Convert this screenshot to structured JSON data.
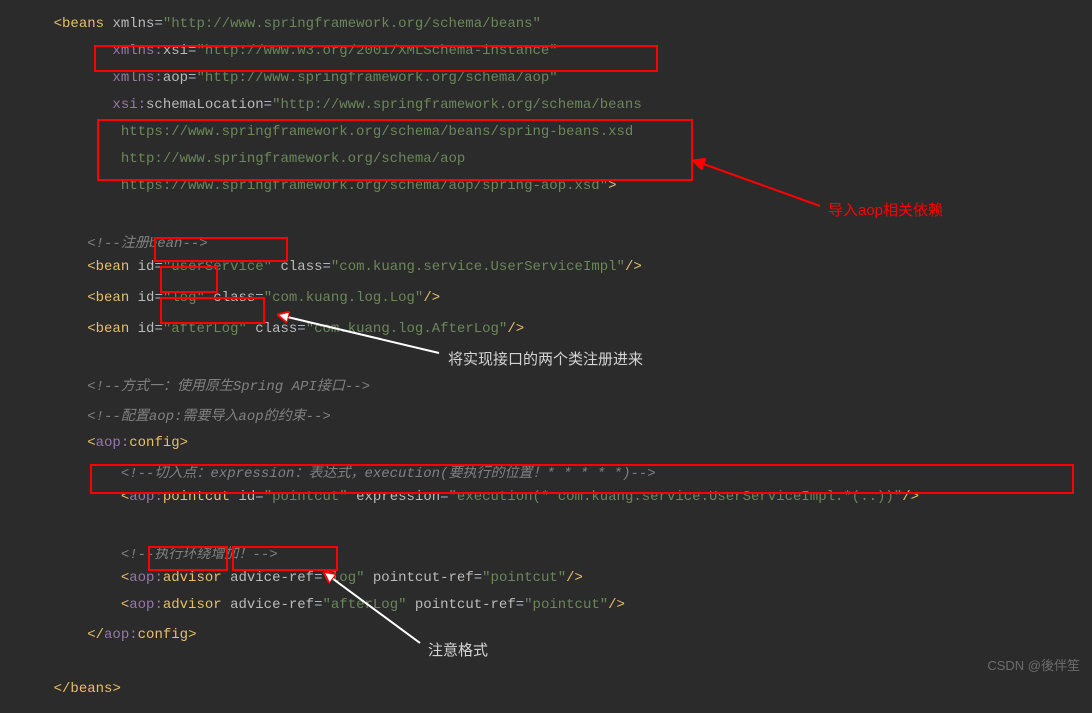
{
  "lines": {
    "l1": {
      "pre": "<",
      "tag": "beans ",
      "attr": "xmlns",
      "eq": "=",
      "str": "\"http://www.springframework.org/schema/beans\""
    },
    "l2": {
      "ns": "       xmlns:",
      "attr": "xsi",
      "eq": "=",
      "str": "\"http://www.w3.org/2001/XMLSchema-instance\""
    },
    "l3": {
      "ns": "       xmlns:",
      "attr": "aop",
      "eq": "=",
      "str": "\"http://www.springframework.org/schema/aop\""
    },
    "l4": {
      "ns": "       xsi:",
      "attr": "schemaLocation",
      "eq": "=",
      "str": "\"http://www.springframework.org/schema/beans"
    },
    "l5": {
      "str": "        https://www.springframework.org/schema/beans/spring-beans.xsd"
    },
    "l6": {
      "str": "        http://www.springframework.org/schema/aop"
    },
    "l7": {
      "str": "        https://www.springframework.org/schema/aop/spring-aop.xsd\"",
      "close": ">"
    },
    "l8": {
      "comment": "    <!--注册bean-->"
    },
    "l9": {
      "pre": "    <",
      "tag": "bean ",
      "a1": "id",
      "v1": "\"userService\"",
      "a2": "class",
      "v2": "\"com.kuang.service.UserServiceImpl\"",
      "close": "/>"
    },
    "l10": {
      "pre": "    <",
      "tag": "bean ",
      "a1": "id",
      "v1": "\"log\"",
      "a2": "class",
      "v2": "\"com.kuang.log.Log\"",
      "close": "/>"
    },
    "l11": {
      "pre": "    <",
      "tag": "bean ",
      "a1": "id",
      "v1": "\"afterLog\"",
      "a2": "class",
      "v2": "\"com.kuang.log.AfterLog\"",
      "close": "/>"
    },
    "l12": {
      "comment": "    <!--方式一：使用原生Spring API接口-->"
    },
    "l13": {
      "comment": "    <!--配置aop:需要导入aop的约束-->"
    },
    "l14": {
      "pre": "    <",
      "ns": "aop:",
      "tag": "config",
      "close": ">"
    },
    "l15": {
      "comment": "        <!--切入点：expression：表达式，execution(要执行的位置！* * * * *)-->"
    },
    "l16": {
      "pre": "        <",
      "ns": "aop:",
      "tag": "pointcut ",
      "a1": "id",
      "v1": "\"pointcut\"",
      "a2": "expression",
      "v2": "\"execution(* com.kuang.service.UserServiceImpl.*(..))\"",
      "close": "/>"
    },
    "l17": {
      "comment": "        <!--执行环绕增加！-->"
    },
    "l18": {
      "pre": "        <",
      "ns": "aop:",
      "tag": "advisor ",
      "a1": "advice-ref",
      "v1": "\"log\"",
      "a2": "pointcut-ref",
      "v2": "\"pointcut\"",
      "close": "/>"
    },
    "l19": {
      "pre": "        <",
      "ns": "aop:",
      "tag": "advisor ",
      "a1": "advice-ref",
      "v1": "\"afterLog\"",
      "a2": "pointcut-ref",
      "v2": "\"pointcut\"",
      "close": "/>"
    },
    "l20": {
      "pre": "    </",
      "ns": "aop:",
      "tag": "config",
      "close": ">"
    },
    "l21": {
      "pre": "</",
      "tag": "beans",
      "close": ">"
    }
  },
  "annotations": {
    "a1": "导入aop相关依赖",
    "a2": "将实现接口的两个类注册进来",
    "a3": "注意格式"
  },
  "watermark": "CSDN @後伴笙"
}
